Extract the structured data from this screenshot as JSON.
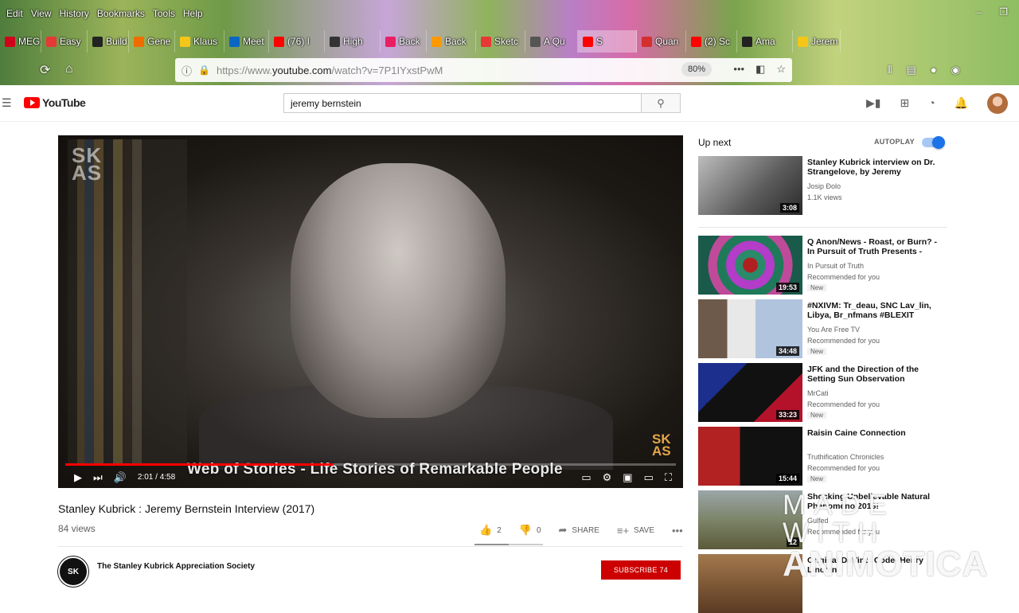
{
  "browser": {
    "menu": [
      "Edit",
      "View",
      "History",
      "Bookmarks",
      "Tools",
      "Help"
    ],
    "tabs": [
      {
        "label": "MEGA",
        "color": "#d0021b"
      },
      {
        "label": "Easy",
        "color": "#e53935"
      },
      {
        "label": "Build",
        "color": "#222222"
      },
      {
        "label": "Gene",
        "color": "#ef6c00"
      },
      {
        "label": "Klaus",
        "color": "#f5c518"
      },
      {
        "label": "Meet",
        "color": "#0a66c2"
      },
      {
        "label": "(76) I",
        "color": "#ff0000"
      },
      {
        "label": "High",
        "color": "#333333"
      },
      {
        "label": "Back",
        "color": "#e91e63"
      },
      {
        "label": "Back",
        "color": "#ff9900"
      },
      {
        "label": "Sketc",
        "color": "#e53935"
      },
      {
        "label": "A Qu",
        "color": "#555555"
      },
      {
        "label": "S",
        "color": "#ff0000"
      },
      {
        "label": "Quan",
        "color": "#d32f2f"
      },
      {
        "label": "(2) Sc",
        "color": "#ff0000"
      },
      {
        "label": "Ama",
        "color": "#222222"
      },
      {
        "label": "Jerem",
        "color": "#f5c518"
      }
    ],
    "url_prefix": "https://www.",
    "url_domain": "youtube.com",
    "url_suffix": "/watch?v=7P1IYxstPwM",
    "zoom": "80%"
  },
  "youtube": {
    "logo_text": "YouTube",
    "search_value": "jeremy bernstein"
  },
  "player": {
    "logo_top": "SK\nAS",
    "logo_corner": "SK\nAS",
    "caption": "Web of Stories - Life Stories of Remarkable People",
    "time": "2:01 / 4:58",
    "progress": 0.44
  },
  "video": {
    "title": "Stanley Kubrick : Jeremy Bernstein Interview (2017)",
    "views": "84 views",
    "likes": "2",
    "dislikes": "0",
    "share": "SHARE",
    "save": "SAVE",
    "channel": "The Stanley Kubrick Appreciation Society",
    "channel_avatar": "SK",
    "subscribe": "SUBSCRIBE  74"
  },
  "sidebar": {
    "up_next": "Up next",
    "autoplay": "AUTOPLAY",
    "recs": [
      {
        "title": "Stanley Kubrick interview on Dr. Strangelove, by Jeremy",
        "channel": "Josip Đolo",
        "meta": "1.1K views",
        "new": "",
        "duration": "3:08",
        "thumb": "linear-gradient(135deg,#bdbdbd,#5a5a5a 60%,#2a2a2a)"
      },
      {
        "title": "Q Anon/News - Roast, or Burn? - In Pursuit of Truth Presents -",
        "channel": "In Pursuit of Truth",
        "meta": "Recommended for you",
        "new": "New",
        "duration": "19:53",
        "thumb": "radial-gradient(circle,#b02020 0 12%,#2a8a6a 13% 25%,#b33cc8 26% 40%,#1f7a5a 41% 55%,#c04a9a 56% 70%,#1a5a4a 71%)"
      },
      {
        "title": "#NXIVM: Tr_deau, SNC Lav_lin, Libya, Br_nfmans #BLEXIT",
        "channel": "You Are Free TV",
        "meta": "Recommended for you",
        "new": "New",
        "duration": "34:48",
        "thumb": "linear-gradient(90deg,#6d5a4a 0 28%,#e8e8e8 28% 55%,#b0c4de 55% 100%)"
      },
      {
        "title": "JFK and the Direction of the Setting Sun Observation",
        "channel": "MrCati",
        "meta": "Recommended for you",
        "new": "New",
        "duration": "33:23",
        "thumb": "linear-gradient(135deg,#1c2f8c 0 30%,#111 30% 70%,#b3122a 70%)"
      },
      {
        "title": "Raisin Caine Connection",
        "channel": "Truthification Chronicles",
        "meta": "Recommended for you",
        "new": "New",
        "duration": "15:44",
        "thumb": "linear-gradient(90deg,#b22222 0 40%,#111 40% 100%)"
      },
      {
        "title": "Shocking Unbelievable Natural Phenomeno 2018!",
        "channel": "Gulfed",
        "meta": "Recommended for you",
        "new": "",
        "duration": "12",
        "thumb": "linear-gradient(180deg,#9aa5a8,#7c8469 50%,#5c5a3a)"
      },
      {
        "title": "Original DaVinci Code~Henry Lincoln",
        "channel": "",
        "meta": "",
        "new": "",
        "duration": "",
        "thumb": "linear-gradient(180deg,#a3794d,#5a3a22)"
      }
    ]
  },
  "watermark": {
    "line1": "MADE WITH",
    "line2": "ANIMOTICA"
  }
}
